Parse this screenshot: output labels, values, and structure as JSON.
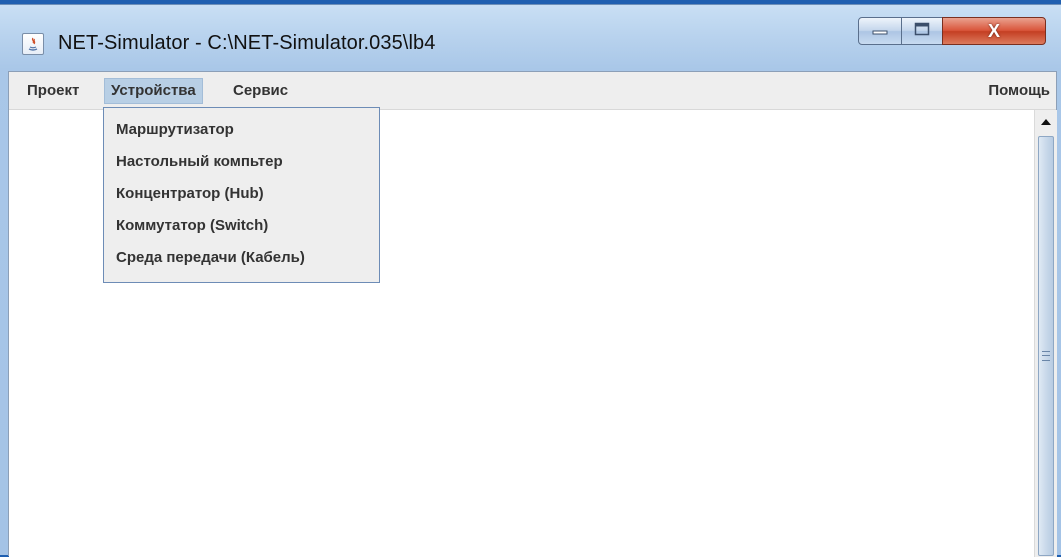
{
  "window": {
    "title": "NET-Simulator - C:\\NET-Simulator.035\\lb4",
    "close_glyph": "X"
  },
  "menubar": {
    "items": [
      {
        "label": "Проект"
      },
      {
        "label": "Устройства"
      },
      {
        "label": "Сервис"
      }
    ],
    "help_label": "Помощь"
  },
  "devices_menu": {
    "items": [
      {
        "label": "Маршрутизатор"
      },
      {
        "label": "Настольный компьтер"
      },
      {
        "label": "Концентратор (Hub)"
      },
      {
        "label": "Коммутатор (Switch)"
      },
      {
        "label": "Среда передачи (Кабель)"
      }
    ]
  },
  "icons": {
    "app": "java-icon",
    "minimize": "minimize-icon",
    "maximize": "maximize-icon",
    "close": "close-icon",
    "scroll_up": "arrow-up-icon",
    "scroll_grip": "grip-icon"
  },
  "colors": {
    "menu_active_bg": "#b8cfe5",
    "dropdown_border": "#6d8cb6",
    "close_button": "#c43e22"
  }
}
